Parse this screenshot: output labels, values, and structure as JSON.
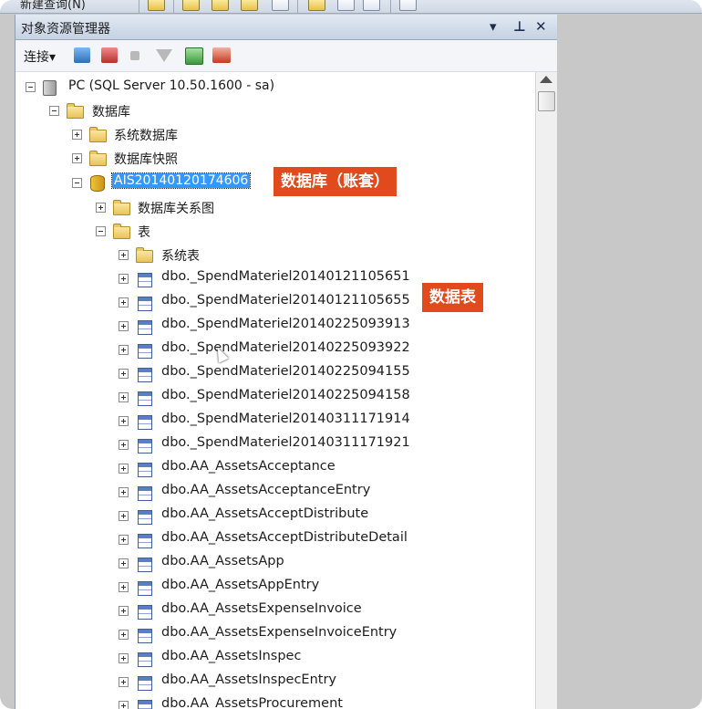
{
  "toolbar": {
    "new_query_label": "新建查询(N)"
  },
  "panel": {
    "title": "对象资源管理器",
    "controls": {
      "dropdown": "▾",
      "pin": "⊥",
      "close": "✕"
    },
    "connect_label": "连接▾"
  },
  "tree": {
    "server": "PC (SQL Server 10.50.1600 - sa)",
    "databases_folder": "数据库",
    "system_databases": "系统数据库",
    "database_snapshots": "数据库快照",
    "database": "AIS20140120174606",
    "diagrams_folder": "数据库关系图",
    "tables_folder": "表",
    "system_tables": "系统表",
    "tables": [
      "dbo._SpendMateriel20140121105651",
      "dbo._SpendMateriel20140121105655",
      "dbo._SpendMateriel20140225093913",
      "dbo._SpendMateriel20140225093922",
      "dbo._SpendMateriel20140225094155",
      "dbo._SpendMateriel20140225094158",
      "dbo._SpendMateriel20140311171914",
      "dbo._SpendMateriel20140311171921",
      "dbo.AA_AssetsAcceptance",
      "dbo.AA_AssetsAcceptanceEntry",
      "dbo.AA_AssetsAcceptDistribute",
      "dbo.AA_AssetsAcceptDistributeDetail",
      "dbo.AA_AssetsApp",
      "dbo.AA_AssetsAppEntry",
      "dbo.AA_AssetsExpenseInvoice",
      "dbo.AA_AssetsExpenseInvoiceEntry",
      "dbo.AA_AssetsInspec",
      "dbo.AA_AssetsInspecEntry",
      "dbo.AA_AssetsProcurement"
    ]
  },
  "annotations": {
    "database_callout": "数据库（账套）",
    "table_callout": "数据表"
  },
  "colors": {
    "callout": "#e04a1c",
    "selection": "#3399ff"
  }
}
